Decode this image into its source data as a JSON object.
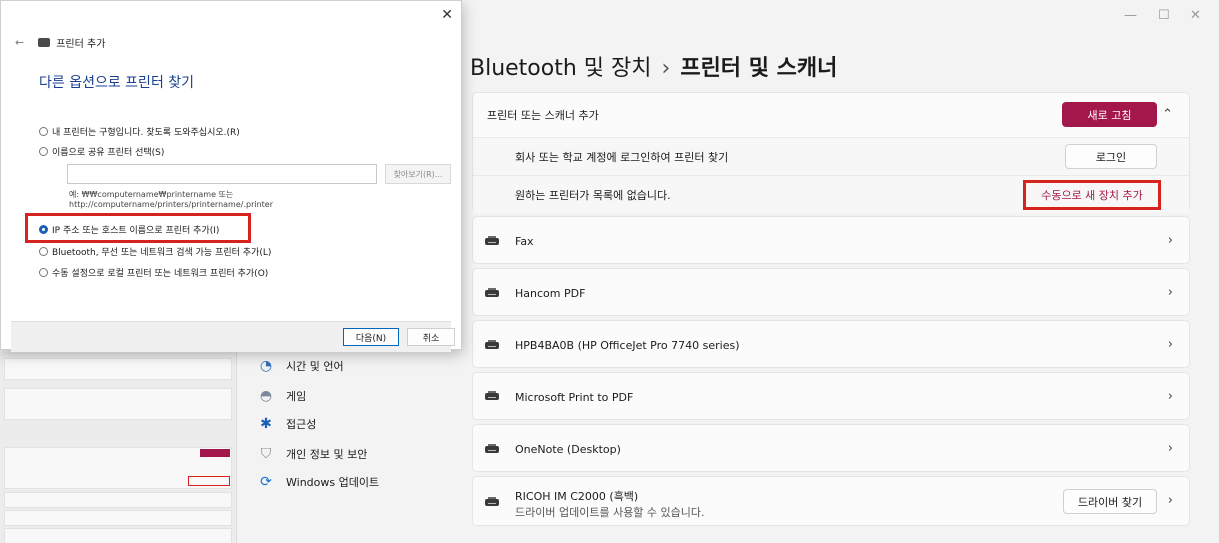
{
  "window": {
    "minimize": "—",
    "maximize": "☐",
    "close": "✕"
  },
  "breadcrumb": {
    "parent": "Bluetooth 및 장치",
    "separator": "›",
    "current": "프린터 및 스캐너"
  },
  "add_section": {
    "label": "프린터 또는 스캐너 추가",
    "refresh_button": "새로 고침",
    "collapse_icon": "chevron-up",
    "work_row": {
      "label": "회사 또는 학교 계정에 로그인하여 프린터 찾기",
      "button": "로그인"
    },
    "missing_row": {
      "label": "원하는 프린터가 목록에 없습니다.",
      "button": "수동으로 새 장치 추가"
    }
  },
  "printers": [
    {
      "name": "Fax"
    },
    {
      "name": "Hancom PDF"
    },
    {
      "name": "HPB4BA0B (HP OfficeJet Pro 7740 series)"
    },
    {
      "name": "Microsoft Print to PDF"
    },
    {
      "name": "OneNote (Desktop)"
    },
    {
      "name": "RICOH IM C2000 (흑백)",
      "subtitle": "드라이버 업데이트를 사용할 수 있습니다.",
      "button": "드라이버 찾기"
    }
  ],
  "nav": [
    {
      "label": "시간 및 언어",
      "icon": "globe-clock-icon"
    },
    {
      "label": "게임",
      "icon": "gamepad-icon"
    },
    {
      "label": "접근성",
      "icon": "accessibility-icon"
    },
    {
      "label": "개인 정보 및 보안",
      "icon": "shield-icon"
    },
    {
      "label": "Windows 업데이트",
      "icon": "update-icon"
    }
  ],
  "dialog": {
    "close": "✕",
    "header": "프린터 추가",
    "heading": "다른 옵션으로 프린터 찾기",
    "options": [
      "내 프린터는 구형입니다. 찾도록 도와주십시오.(R)",
      "이름으로 공유 프린터 선택(S)",
      "IP 주소 또는 호스트 이름으로 프린터 추가(I)",
      "Bluetooth, 무선 또는 네트워크 검색 가능 프린터 추가(L)",
      "수동 설정으로 로컬 프린터 또는 네트워크 프린터 추가(O)"
    ],
    "selected_option": "IP 주소 또는 호스트 이름으로 프린터 추가(I)",
    "share_input_value": "",
    "browse_button": "찾아보기(R)...",
    "example_line1": "예: ₩₩computername₩printername 또는",
    "example_line2": "http://computername/printers/printername/.printer",
    "next_button": "다음(N)",
    "cancel_button": "취소"
  },
  "colors": {
    "accent": "#a3174a",
    "highlight": "#d6231e",
    "dialog_heading": "#1a3f91"
  }
}
